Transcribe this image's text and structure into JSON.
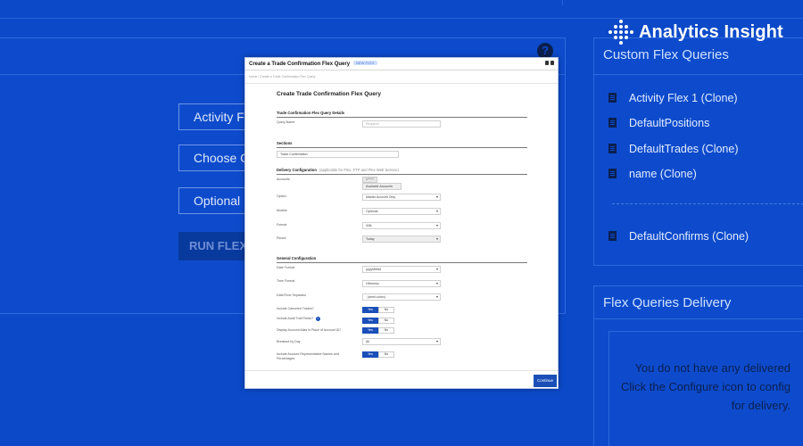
{
  "brand": {
    "name": "Analytics Insight"
  },
  "background": {
    "buttons": [
      "Activity F",
      "Choose C",
      "Optional"
    ],
    "run_button": "RUN FLEX Q",
    "help_glyph": "?"
  },
  "custom_flex_queries": {
    "title": "Custom Flex Queries",
    "items": [
      "Activity Flex 1 (Clone)",
      "DefaultPositions",
      "DefaultTrades (Clone)",
      "name (Clone)"
    ],
    "extra_item": "DefaultConfirms (Clone)"
  },
  "flex_delivery": {
    "title": "Flex Queries Delivery",
    "message_lines": [
      "You do not have any delivered",
      "Click the Configure icon to config",
      "for delivery."
    ]
  },
  "modal": {
    "title": "Create a Trade Confirmation Flex Query",
    "badge": "NEW FLEX",
    "breadcrumb": "Home  /  Create a Trade Confirmation Flex Query",
    "heading": "Create Trade Confirmation Flex Query",
    "details": {
      "section": "Trade Confirmation Flex Query Details",
      "query_name_label": "Query Name",
      "query_name_placeholder": "Required"
    },
    "sections_block": {
      "section": "Sections",
      "value": "Trade Confirmation"
    },
    "delivery": {
      "section": "Delivery Configuration",
      "note": "(applicable for Flex, FTP and Flex Web Service)",
      "accounts_label": "Accounts",
      "accounts_chip": "U*****",
      "accounts_value": "Available Accounts",
      "models_label": "Option",
      "models_value": "Master Account Only",
      "model_label": "Models",
      "model_value": "Optional",
      "format_label": "Format",
      "format_value": "XML",
      "period_label": "Period",
      "period_value": "Today"
    },
    "general": {
      "section": "General Configuration",
      "rows": [
        {
          "label": "Date Format",
          "value": "yyyyMMdd"
        },
        {
          "label": "Time Format",
          "value": "HHmmss"
        },
        {
          "label": "Date/Time Separator",
          "value": "; (semi-colon)"
        }
      ],
      "toggles": [
        {
          "label": "Include Canceled Trades?",
          "yes": "Yes",
          "no": "No"
        },
        {
          "label": "Include Audit Trail Fields?",
          "yes": "Yes",
          "no": "No",
          "info": "i"
        },
        {
          "label": "Display Account Alias in Place of Account ID?",
          "yes": "Yes",
          "no": "No"
        }
      ],
      "breakout_label": "Breakout by Day",
      "breakout_value": "All",
      "last_toggle": {
        "label": "Include Account Representative Names and Percentages",
        "yes": "Yes",
        "no": "No"
      }
    },
    "continue_label": "Continue"
  }
}
